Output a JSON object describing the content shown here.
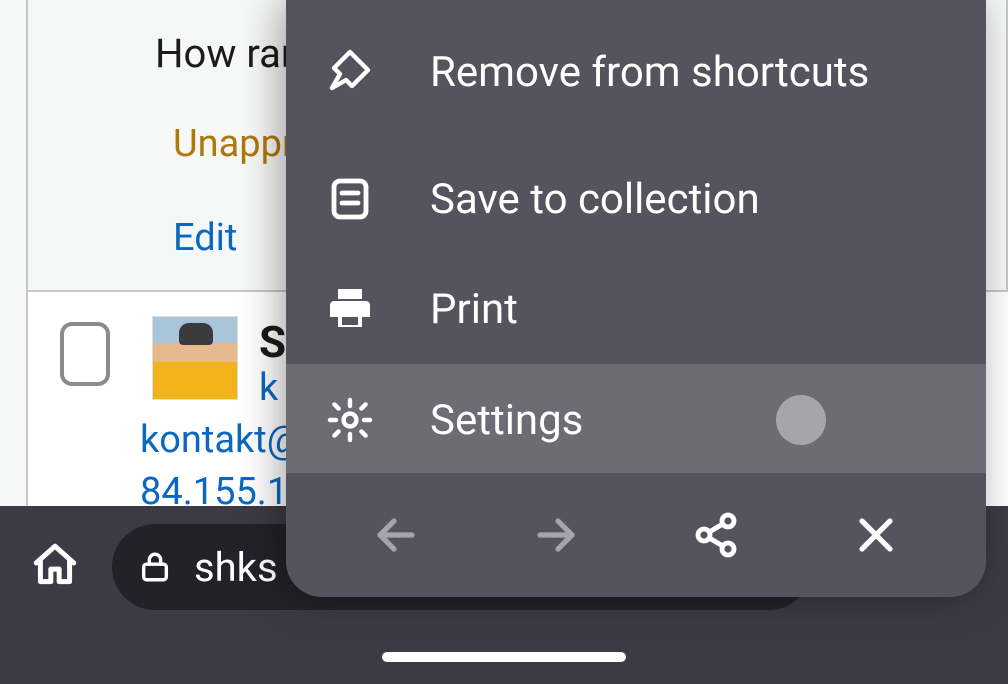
{
  "page": {
    "title_fragment": "How ran",
    "status_fragment": "Unappr",
    "edit_label": "Edit",
    "row": {
      "name_fragment": "S",
      "link_fragment": "k",
      "email_fragment": "kontakt@",
      "ip_fragment": "84.155.1"
    }
  },
  "navbar": {
    "url_fragment": "shks"
  },
  "menu": {
    "remove_shortcuts": "Remove from shortcuts",
    "save_collection": "Save to collection",
    "print": "Print",
    "settings": "Settings"
  }
}
